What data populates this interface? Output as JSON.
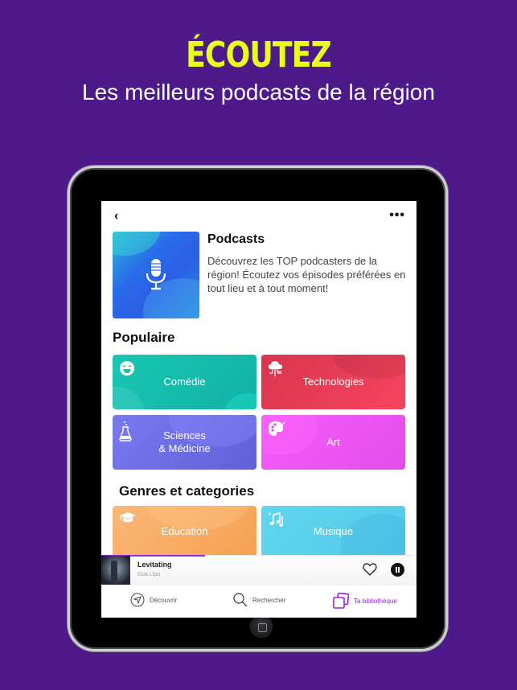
{
  "promo": {
    "title": "ÉCOUTEZ",
    "subtitle": "Les meilleurs podcasts de la région"
  },
  "colors": {
    "background": "#4e1a8a",
    "title_accent": "#e8ff1a",
    "active_tab": "#9b1ee0"
  },
  "nav": {
    "back_icon": "chevron-left-icon",
    "back_glyph": "‹",
    "more_icon": "more-horizontal-icon",
    "more_glyph": "•••"
  },
  "hero": {
    "icon": "microphone-icon",
    "title": "Podcasts",
    "description": "Découvrez les TOP podcasters de la région! Écoutez vos épisodes préférées en tout lieu et à tout moment!"
  },
  "sections": {
    "popular": {
      "title": "Populaire",
      "tiles": [
        {
          "label": "Comédie",
          "icon": "laughing-face-icon",
          "color": "#17c2b0"
        },
        {
          "label": "Technologies",
          "icon": "cloud-network-icon",
          "color": "#f03e5c"
        },
        {
          "label": "Sciences\n& Médicine",
          "label_line1": "Sciences",
          "label_line2": "& Médicine",
          "icon": "flask-icon",
          "color": "#7170ea"
        },
        {
          "label": "Art",
          "icon": "palette-icon",
          "color": "#f053f5"
        }
      ]
    },
    "genres": {
      "title": "Genres et categories",
      "tiles": [
        {
          "label": "Education",
          "icon": "graduation-cap-icon",
          "color": "#f9ac5e"
        },
        {
          "label": "Musique",
          "icon": "music-notes-icon",
          "color": "#5fd3ef"
        }
      ]
    }
  },
  "player": {
    "track_title": "Levitating",
    "artist": "Dua Lipa",
    "progress": 0.33,
    "like_icon": "heart-icon",
    "pause_icon": "pause-icon"
  },
  "tabbar": {
    "items": [
      {
        "label": "Découvrir",
        "icon": "compass-icon",
        "active": false
      },
      {
        "label": "Rechercher",
        "icon": "search-icon",
        "active": false
      },
      {
        "label": "Ta bibliothèque",
        "icon": "library-icon",
        "active": true
      }
    ]
  }
}
